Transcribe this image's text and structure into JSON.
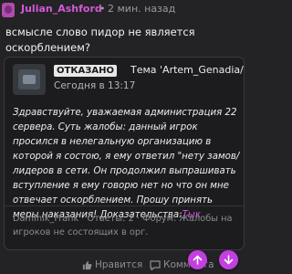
{
  "post": {
    "username": "Julian_Ashford",
    "separator": "•",
    "time": "2 мин. назад",
    "question": "всмысле слово пидор не является оскорблением?"
  },
  "quote": {
    "status_badge": "ОТКАЗАНО",
    "thread_title": "Тема 'Artem_Genadia/...",
    "date": "Сегодня в 13:17",
    "body_text": "Здравствуйте, уважаемая администрация 22 сервера. Суть жалобы: данный игрок просился в нелегальную организацию в которой я состою, я ему ответил \"нету замов/лидеров в сети. Он продолжил выпрашивать вступление я ему говорю нет но что он мне отвечает оскорблением. Прошу принять меры наказания! Доказательства:",
    "evidence_link": "Тык",
    "meta": "Daminik_Frank · Ответы: 2 · Форум: Жалобы на игроков не состоящих в орг."
  },
  "footer": {
    "like_label": "Нравится",
    "comment_label": "Комментарии"
  },
  "colors": {
    "accent": "#d25ad6",
    "fab": "#c43fe0",
    "background": "#232326"
  },
  "icons": {
    "like": "thumbs-up-icon",
    "comment": "comment-icon",
    "scroll_up": "arrow-up-icon",
    "scroll_down": "arrow-down-icon"
  }
}
